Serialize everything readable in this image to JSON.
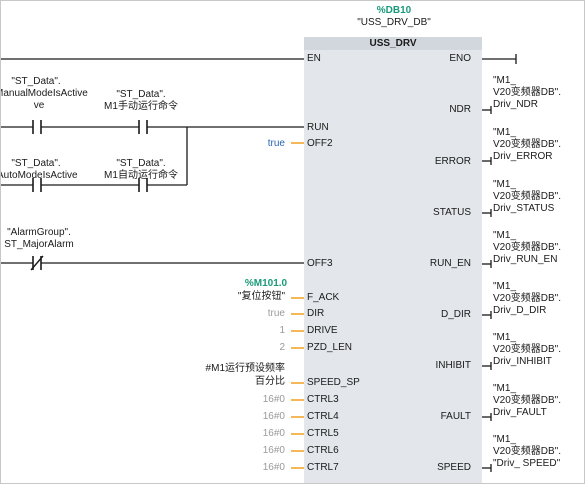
{
  "block": {
    "db_addr": "%DB10",
    "db_name": "\"USS_DRV_DB\"",
    "type": "USS_DRV"
  },
  "pins_in": {
    "en": "EN",
    "run": "RUN",
    "off2": "OFF2",
    "off3": "OFF3",
    "f_ack": "F_ACK",
    "dir": "DIR",
    "drive": "DRIVE",
    "pzd_len": "PZD_LEN",
    "speed_sp": "SPEED_SP",
    "ctrl3": "CTRL3",
    "ctrl4": "CTRL4",
    "ctrl5": "CTRL5",
    "ctrl6": "CTRL6",
    "ctrl7": "CTRL7"
  },
  "pins_out": {
    "eno": "ENO",
    "ndr": "NDR",
    "error": "ERROR",
    "status": "STATUS",
    "run_en": "RUN_EN",
    "d_dir": "D_DIR",
    "inhibit": "INHIBIT",
    "fault": "FAULT",
    "speed": "SPEED"
  },
  "contacts": {
    "manual_db": "\"ST_Data\".",
    "manual_tag": "ManualModeIsActive",
    "manual_tag_wrap": "ve",
    "manual_cmd_db": "\"ST_Data\".",
    "manual_cmd_tag": "M1手动运行命令",
    "auto_db": "\"ST_Data\".",
    "auto_tag": "AutoModeIsActive",
    "auto_cmd_db": "\"ST_Data\".",
    "auto_cmd_tag": "M1自动运行命令",
    "alarm_db": "\"AlarmGroup\".",
    "alarm_tag": "ST_MajorAlarm"
  },
  "params": {
    "off2_val": "true",
    "reset_addr": "%M101.0",
    "reset_name": "\"复位按钮\"",
    "dir_val": "true",
    "drive_val": "1",
    "pzd_len_val": "2",
    "speed_sp_line1": "#M1运行预设频率",
    "speed_sp_line2": "百分比",
    "ctrl3_val": "16#0",
    "ctrl4_val": "16#0",
    "ctrl5_val": "16#0",
    "ctrl6_val": "16#0",
    "ctrl7_val": "16#0"
  },
  "outputs": {
    "ndr": [
      "\"M1_",
      "V20变频器DB\".",
      "Driv_NDR"
    ],
    "error": [
      "\"M1_",
      "V20变频器DB\".",
      "Driv_ERROR"
    ],
    "status": [
      "\"M1_",
      "V20变频器DB\".",
      "Driv_STATUS"
    ],
    "run_en": [
      "\"M1_",
      "V20变频器DB\".",
      "Driv_RUN_EN"
    ],
    "d_dir": [
      "\"M1_",
      "V20变频器DB\".",
      "Driv_D_DIR"
    ],
    "inhibit": [
      "\"M1_",
      "V20变频器DB\".",
      "Driv_INHIBIT"
    ],
    "fault": [
      "\"M1_",
      "V20变频器DB\".",
      "Driv_FAULT"
    ],
    "speed": [
      "\"M1_",
      "V20变频器DB\".",
      "\"Driv_ SPEED\""
    ]
  },
  "colors": {
    "wire": "#1a1a1a",
    "box_fill": "#e3e6ea",
    "param_wire": "#f0a020",
    "addr_green": "#1a9a7a",
    "bool_blue": "#2864b4"
  }
}
